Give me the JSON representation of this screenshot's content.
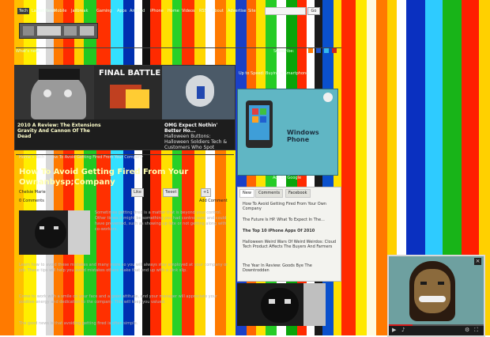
{
  "topbar": {
    "links": [
      "Tech",
      "Latest News",
      "Mobile",
      "Jailbreak",
      "Gaming",
      "Apps",
      "Android",
      "iPhone",
      "Home",
      "Videos",
      "RSS",
      "About",
      "Advertise",
      "Site"
    ],
    "search_button": "Go"
  },
  "logo": {
    "text": ""
  },
  "navbar": {
    "left": "What's new:",
    "right": "Subscribe:"
  },
  "slider": {
    "slides": [
      {
        "caption": "2010 A Review: The Extensions Gravity And Cannon Of The Dead",
        "banner": "FINAL BATTLE"
      },
      {
        "caption": "OMG Expect Nothin' Better Ho...",
        "banner": ""
      },
      {
        "caption": "Halloween Buttons: Halloween Soldiers Tech & Customers Who Spot",
        "banner": ""
      }
    ]
  },
  "article": {
    "crumbs": "Home » Tech » How To Avoid Getting Fired From Your Company",
    "title": "How To Avoid Getting Fired From Your Ownanbysp;Company",
    "byline": "Chelsie Marie",
    "comments": "0 Comments",
    "share_buttons": [
      "Like",
      "Tweet",
      "+1"
    ],
    "comment_link": "Add Comment",
    "paragraphs": [
      "Sometimes getting fired is a matter that is beyond your control. Other times it might be something you had control over and could have prevented, such as showing up late or not getting along with co-workers.",
      "Learn how to avoid these mistakes and many more so you will always stay employed at your company or job. These tips will help you avoid mistakes others make that end up with a pink slip.",
      "Come to work with a smile on your face and a good attitude, and your manager will appreciate your positive energy and dedication to the company. This will keep you valued.",
      "The good news is that avoiding getting fired is often simple."
    ]
  },
  "sidebar": {
    "heading": "Up to Speed: Buying a Smartphone",
    "ad": {
      "brand": "Windows Phone",
      "footer": "Ads by Google"
    },
    "tabs": [
      "New",
      "Comments",
      "Facebook"
    ],
    "items": [
      "How To Avoid Getting Fired From Your Own Company",
      "The Future Is HP. What To Expect In The...",
      "The Top 10 iPhone Apps Of 2010",
      "Halloween Weird Wars Of Weird Weirdos: Cloud Tech Product Affects The Buyers And Farmers",
      "The Year In Review: Goods Bye The Downtrodden"
    ]
  },
  "video": {
    "close": "×"
  },
  "colors": {
    "stripes": [
      "#ff7a00",
      "#ffd000",
      "#ffe800",
      "#ffffff",
      "#e8e8e8",
      "#ff7a00",
      "#ff2a00",
      "#ffd000",
      "#26c226",
      "#ff2a00",
      "#0a2ab8",
      "#f6f6f6",
      "#ff2a00",
      "#ffe000",
      "#2bd72b",
      "#000000",
      "#0a58cc",
      "#3cd4ff",
      "#00a000",
      "#ff0000",
      "#1040d0",
      "#ff6a00",
      "#ffd000",
      "#2ad22a",
      "#ffffff",
      "#11b411",
      "#0033aa",
      "#f9f9f9"
    ]
  }
}
